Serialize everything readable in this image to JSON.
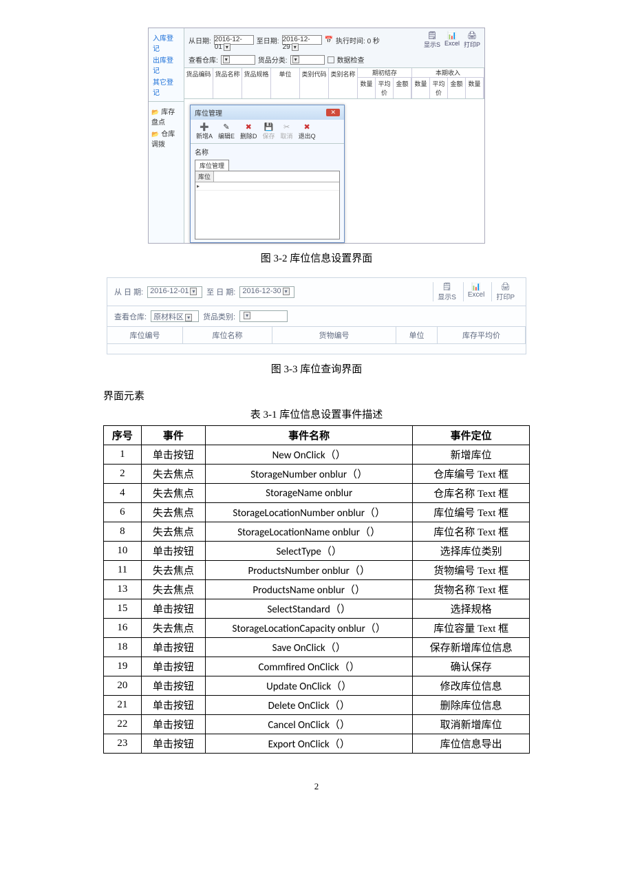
{
  "shot1": {
    "side_links": [
      "入库登记",
      "出库登记",
      "其它登记"
    ],
    "side_folders": [
      "库存盘点",
      "仓库调拨"
    ],
    "filter": {
      "from_lbl": "从日期:",
      "from_val": "2016-12-01",
      "to_lbl": "至日期:",
      "to_val": "2016-12-29",
      "wh_lbl": "查看仓库:",
      "cat_lbl": "货品分类:",
      "exec_lbl": "执行时间: 0 秒",
      "chk_lbl": "数据检查"
    },
    "toolbar": [
      {
        "icon": "🗒",
        "txt": "显示S"
      },
      {
        "icon": "📊",
        "txt": "Excel"
      },
      {
        "icon": "🖨",
        "txt": "打印P"
      }
    ],
    "cols_top": [
      "货品编码",
      "货品名称",
      "货品规格",
      "单位",
      "类别代码",
      "类别名称"
    ],
    "cols_grp": [
      {
        "title": "期初结存",
        "sub": [
          "数量",
          "平均价",
          "金额"
        ]
      },
      {
        "title": "本期收入",
        "sub": [
          "数量",
          "平均价",
          "金额",
          "数量"
        ]
      }
    ],
    "dialog": {
      "title": "库位管理",
      "buttons": [
        {
          "icon": "➕",
          "txt": "新增A",
          "cls": "red"
        },
        {
          "icon": "✎",
          "txt": "编辑E"
        },
        {
          "icon": "✖",
          "txt": "删除D",
          "cls": "red"
        },
        {
          "icon": "💾",
          "txt": "保存",
          "cls": "gray"
        },
        {
          "icon": "✂",
          "txt": "取消",
          "cls": "gray"
        },
        {
          "icon": "✖",
          "txt": "退出Q",
          "cls": "red"
        }
      ],
      "name_lbl": "名称",
      "tab": "库位管理",
      "grid_col": "库位"
    }
  },
  "caption1": "图 3-2  库位信息设置界面",
  "shot2": {
    "from_lbl": "从 日 期:",
    "from_val": "2016-12-01",
    "to_lbl": "至 日 期:",
    "to_val": "2016-12-30",
    "wh_lbl": "查看仓库:",
    "wh_val": "原材料区",
    "cat_lbl": "货品类别:",
    "toolbar": [
      {
        "icon": "🗒",
        "txt": "显示S"
      },
      {
        "icon": "📊",
        "txt": "Excel"
      },
      {
        "icon": "🖨",
        "txt": "打印P"
      }
    ],
    "cols": [
      "库位编号",
      "库位名称",
      "货物编号",
      "单位",
      "库存平均价"
    ]
  },
  "caption2": "图 3-3  库位查询界面",
  "section_title": "界面元素",
  "table_caption": "表 3-1  库位信息设置事件描述",
  "table_headers": [
    "序号",
    "事件",
    "事件名称",
    "事件定位"
  ],
  "table_rows": [
    {
      "no": "1",
      "ev": "单击按钮",
      "name": "New OnClick（）",
      "loc": "新增库位"
    },
    {
      "no": "2",
      "ev": "失去焦点",
      "name": "StorageNumber onblur（）",
      "loc": "仓库编号 Text 框"
    },
    {
      "no": "4",
      "ev": "失去焦点",
      "name": "StorageName onblur",
      "loc": "仓库名称 Text 框"
    },
    {
      "no": "6",
      "ev": "失去焦点",
      "name": "StorageLocationNumber onblur（）",
      "loc": "库位编号 Text 框"
    },
    {
      "no": "8",
      "ev": "失去焦点",
      "name": "StorageLocationName onblur（）",
      "loc": "库位名称 Text 框"
    },
    {
      "no": "10",
      "ev": "单击按钮",
      "name": "SelectType（）",
      "loc": "选择库位类别"
    },
    {
      "no": "11",
      "ev": "失去焦点",
      "name": "ProductsNumber onblur（）",
      "loc": "货物编号 Text 框"
    },
    {
      "no": "13",
      "ev": "失去焦点",
      "name": "ProductsName onblur（）",
      "loc": "货物名称 Text 框"
    },
    {
      "no": "15",
      "ev": "单击按钮",
      "name": "SelectStandard（）",
      "loc": "选择规格"
    },
    {
      "no": "16",
      "ev": "失去焦点",
      "name": "StorageLocationCapacity onblur（）",
      "loc": "库位容量 Text 框"
    },
    {
      "no": "18",
      "ev": "单击按钮",
      "name": "Save OnClick（）",
      "loc": "保存新增库位信息"
    },
    {
      "no": "19",
      "ev": "单击按钮",
      "name": "Commfired OnClick（）",
      "loc": "确认保存"
    },
    {
      "no": "20",
      "ev": "单击按钮",
      "name": "Update OnClick（）",
      "loc": "修改库位信息"
    },
    {
      "no": "21",
      "ev": "单击按钮",
      "name": "Delete OnClick（）",
      "loc": "删除库位信息"
    },
    {
      "no": "22",
      "ev": "单击按钮",
      "name": "Cancel OnClick（）",
      "loc": "取消新增库位"
    },
    {
      "no": "23",
      "ev": "单击按钮",
      "name": "Export OnClick（）",
      "loc": "库位信息导出"
    }
  ],
  "page_number": "2"
}
